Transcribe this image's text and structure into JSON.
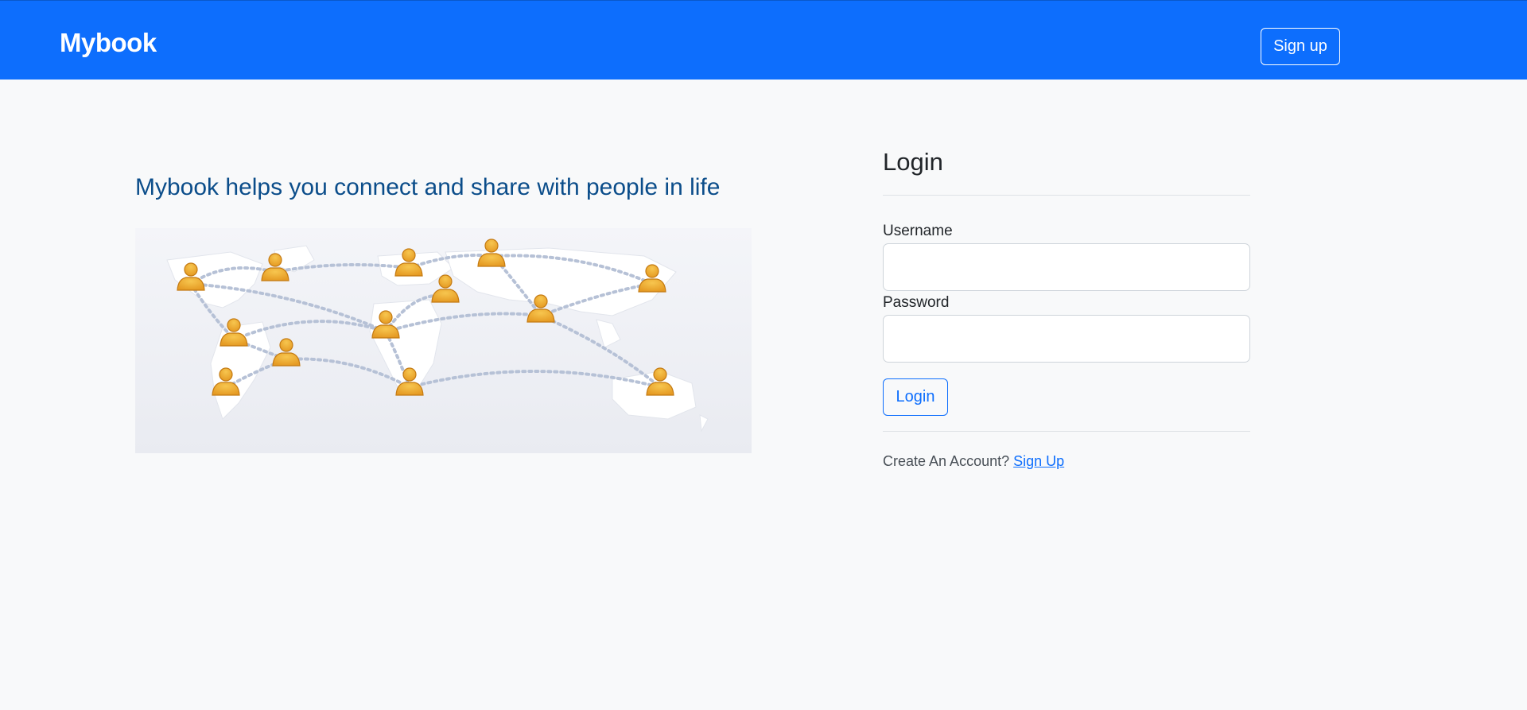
{
  "navbar": {
    "brand": "Mybook",
    "signup_button": "Sign up",
    "background_color": "#0d6efd"
  },
  "hero": {
    "tagline": "Mybook helps you connect and share with people in life",
    "image": "world-map-people-network-illustration"
  },
  "login": {
    "title": "Login",
    "username_label": "Username",
    "username_value": "",
    "password_label": "Password",
    "password_value": "",
    "submit_button": "Login",
    "create_prompt": "Create An Account?",
    "signup_link": "Sign Up"
  },
  "colors": {
    "primary": "#0d6efd",
    "tagline": "#0b4d8a",
    "background": "#f8f9fa"
  }
}
